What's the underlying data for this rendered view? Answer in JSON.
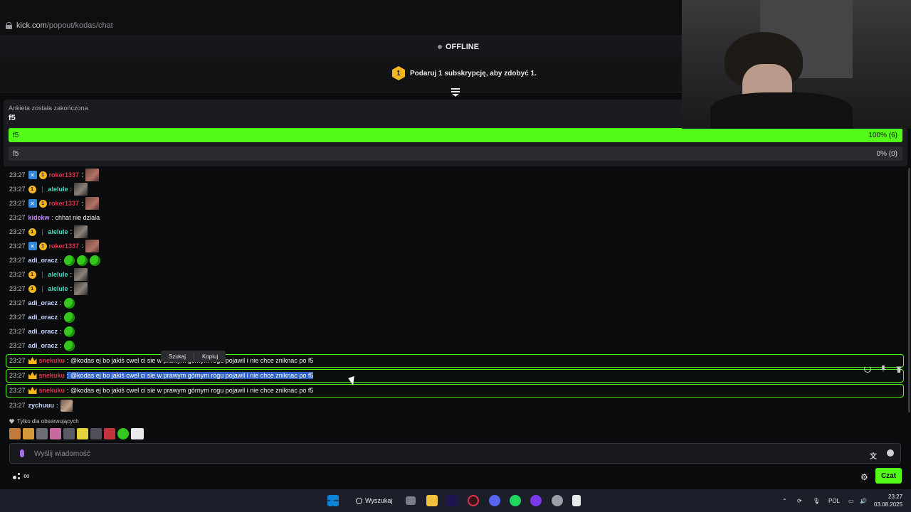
{
  "browser": {
    "url_domain": "kick.com",
    "url_path": "/popout/kodas/chat"
  },
  "stream_status": "OFFLINE",
  "sub_promo": {
    "badge": "1",
    "text": "Podaruj 1 subskrypcję, aby zdobyć 1."
  },
  "poll": {
    "title": "Ankieta została zakończona",
    "question": "f5",
    "options": [
      {
        "label": "f5",
        "percent_text": "100% (6)",
        "fraction": 1.0
      },
      {
        "label": "f5",
        "percent_text": "0% (0)",
        "fraction": 0.0
      }
    ]
  },
  "messages": [
    {
      "time": "23:27",
      "user": "roker1337",
      "badges": [
        "blue",
        "gold"
      ],
      "text": ":",
      "emote": "photo"
    },
    {
      "time": "23:27",
      "user": "alelule",
      "badges": [
        "gold",
        "sep"
      ],
      "text": ":",
      "emote": "photo2"
    },
    {
      "time": "23:27",
      "user": "roker1337",
      "badges": [
        "blue",
        "gold"
      ],
      "text": ":",
      "emote": "photo"
    },
    {
      "time": "23:27",
      "user": "kidekw",
      "badges": [],
      "text": ": chhat nie dziala",
      "emote": ""
    },
    {
      "time": "23:27",
      "user": "alelule",
      "badges": [
        "gold",
        "sep"
      ],
      "text": ":",
      "emote": "photo2"
    },
    {
      "time": "23:27",
      "user": "roker1337",
      "badges": [
        "blue",
        "gold"
      ],
      "text": ":",
      "emote": "photo"
    },
    {
      "time": "23:27",
      "user": "adi_oracz",
      "badges": [],
      "text": ":",
      "emote": "green3"
    },
    {
      "time": "23:27",
      "user": "alelule",
      "badges": [
        "gold",
        "sep"
      ],
      "text": ":",
      "emote": "photo2"
    },
    {
      "time": "23:27",
      "user": "alelule",
      "badges": [
        "gold",
        "sep"
      ],
      "text": ":",
      "emote": "photo2"
    },
    {
      "time": "23:27",
      "user": "adi_oracz",
      "badges": [],
      "text": ":",
      "emote": "green"
    },
    {
      "time": "23:27",
      "user": "adi_oracz",
      "badges": [],
      "text": ":",
      "emote": "green"
    },
    {
      "time": "23:27",
      "user": "adi_oracz",
      "badges": [],
      "text": ":",
      "emote": "green"
    },
    {
      "time": "23:27",
      "user": "adi_oracz",
      "badges": [],
      "text": ":",
      "emote": "green"
    }
  ],
  "highlighted": [
    {
      "time": "23:27",
      "user": "snekuku",
      "text": ": @kodas ej bo jakiś cwel ci sie w prawym górnym rogu pojawil i nie chce zniknac po f5"
    },
    {
      "time": "23:27",
      "user": "snekuku",
      "text": ": @kodas ej bo jakiś cwel ci sie w prawym górnym rogu pojawil i nie chce zniknac po f5"
    },
    {
      "time": "23:27",
      "user": "snekuku",
      "text": ": @kodas ej bo jakiś cwel ci sie w prawym górnym rogu pojawil i nie chce zniknac po f5"
    }
  ],
  "last_message": {
    "time": "23:27",
    "user": "zychuuu",
    "text": ":"
  },
  "context_menu": {
    "search": "Szukaj",
    "copy": "Kopiuj"
  },
  "followers_only": "Tylko dla obserwujących",
  "input": {
    "placeholder": "Wyślij wiadomość"
  },
  "chat_button": "Czat",
  "taskbar": {
    "search": "Wyszukaj",
    "lang": "POL",
    "time": "23:27",
    "date": "03.08.2025"
  },
  "colors": {
    "accent": "#53fc18",
    "roker": "#e0324e",
    "alelule": "#3ee0c0",
    "kidekw": "#c58af9",
    "adi": "#c8d8ff",
    "snekuku": "#e0324e",
    "zychuuu": "#c8d8ff"
  }
}
